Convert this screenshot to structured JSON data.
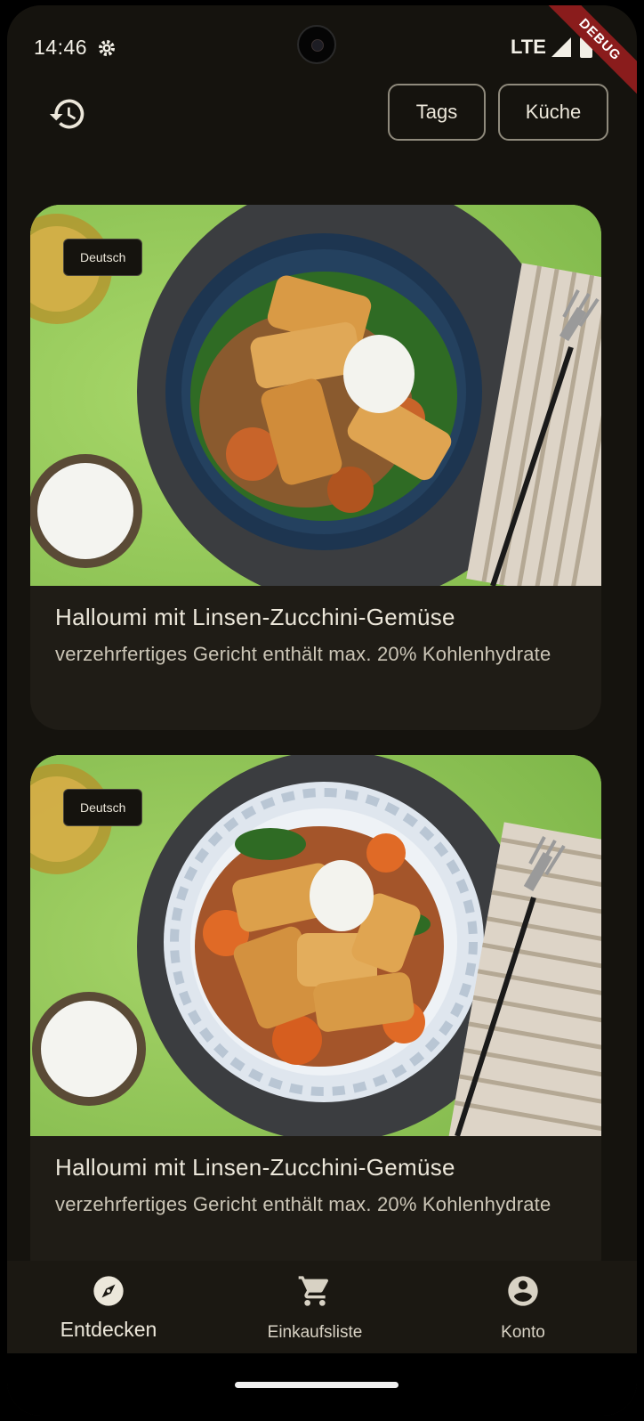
{
  "status_bar": {
    "time": "14:46",
    "network": "LTE",
    "debug_banner": "DEBUG"
  },
  "top_bar": {
    "history_icon": "history-icon",
    "filters": [
      {
        "label": "Tags"
      },
      {
        "label": "Küche"
      }
    ]
  },
  "recipes": [
    {
      "language": "Deutsch",
      "title": "Halloumi mit Linsen-Zucchini-Gemüse",
      "subtitle": "verzehrfertiges Gericht enthält max. 20% Kohlenhydrate"
    },
    {
      "language": "Deutsch",
      "title": "Halloumi mit Linsen-Zucchini-Gemüse",
      "subtitle": "verzehrfertiges Gericht enthält max. 20% Kohlenhydrate"
    }
  ],
  "bottom_nav": {
    "items": [
      {
        "label": "Entdecken",
        "icon": "compass-icon",
        "selected": true
      },
      {
        "label": "Einkaufsliste",
        "icon": "shopping-cart-icon",
        "selected": false
      },
      {
        "label": "Konto",
        "icon": "account-circle-icon",
        "selected": false
      }
    ]
  },
  "colors": {
    "background": "#15130e",
    "card": "#1f1c16",
    "text": "#ece7da",
    "chip_border": "#8f8a7c",
    "debug_ribbon": "#8a1c1c"
  }
}
